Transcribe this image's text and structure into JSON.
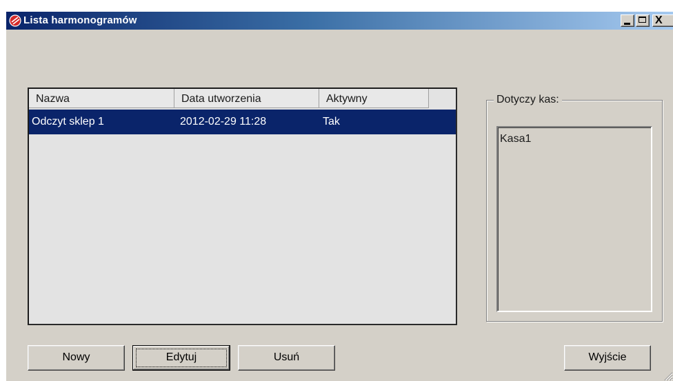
{
  "window": {
    "title": "Lista harmonogramów",
    "close_glyph": "X",
    "icon": "app-logo-icon"
  },
  "list": {
    "columns": [
      "Nazwa",
      "Data utworzenia",
      "Aktywny"
    ],
    "rows": [
      {
        "nazwa": "Odczyt sklep 1",
        "data": "2012-02-29 11:28",
        "aktywny": "Tak",
        "selected": true
      }
    ]
  },
  "group": {
    "label": "Dotyczy kas:",
    "items": [
      "Kasa1"
    ]
  },
  "buttons": {
    "nowy": "Nowy",
    "edytuj": "Edytuj",
    "usun": "Usuń",
    "wyjscie": "Wyjście"
  },
  "colors": {
    "selection": "#0a246a",
    "face": "#d4d0c8",
    "logo": "#d42a2a"
  }
}
